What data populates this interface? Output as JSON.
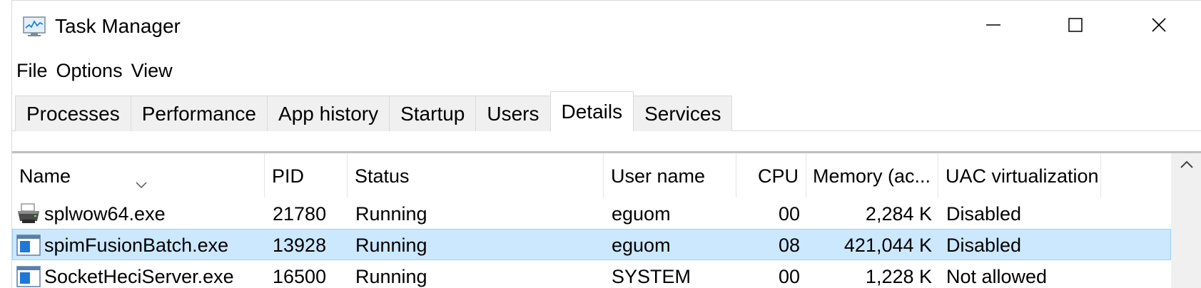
{
  "window": {
    "title": "Task Manager",
    "controls": {
      "minimize": "minimize-icon",
      "maximize": "maximize-icon",
      "close": "close-icon"
    }
  },
  "menu": [
    {
      "label": "File"
    },
    {
      "label": "Options"
    },
    {
      "label": "View"
    }
  ],
  "tabs": [
    {
      "label": "Processes",
      "active": false
    },
    {
      "label": "Performance",
      "active": false
    },
    {
      "label": "App history",
      "active": false
    },
    {
      "label": "Startup",
      "active": false
    },
    {
      "label": "Users",
      "active": false
    },
    {
      "label": "Details",
      "active": true
    },
    {
      "label": "Services",
      "active": false
    }
  ],
  "columns": {
    "name": "Name",
    "pid": "PID",
    "status": "Status",
    "user": "User name",
    "cpu": "CPU",
    "memory": "Memory (ac...",
    "uac": "UAC virtualization"
  },
  "sort": {
    "column": "name",
    "direction": "descending",
    "icon": "chevron-down-icon"
  },
  "rows": [
    {
      "name": "splwow64.exe",
      "pid": "21780",
      "status": "Running",
      "user": "eguom",
      "cpu": "00",
      "memory": "2,284 K",
      "uac": "Disabled",
      "icon": "printer-icon",
      "selected": false
    },
    {
      "name": "spimFusionBatch.exe",
      "pid": "13928",
      "status": "Running",
      "user": "eguom",
      "cpu": "08",
      "memory": "421,044 K",
      "uac": "Disabled",
      "icon": "app-window-icon",
      "selected": true
    },
    {
      "name": "SocketHeciServer.exe",
      "pid": "16500",
      "status": "Running",
      "user": "SYSTEM",
      "cpu": "00",
      "memory": "1,228 K",
      "uac": "Not allowed",
      "icon": "app-window-icon",
      "selected": false
    }
  ],
  "colors": {
    "selection_bg": "#cce8ff",
    "selection_border": "#99d1ff",
    "tab_inactive_bg": "#f0f0f0"
  }
}
